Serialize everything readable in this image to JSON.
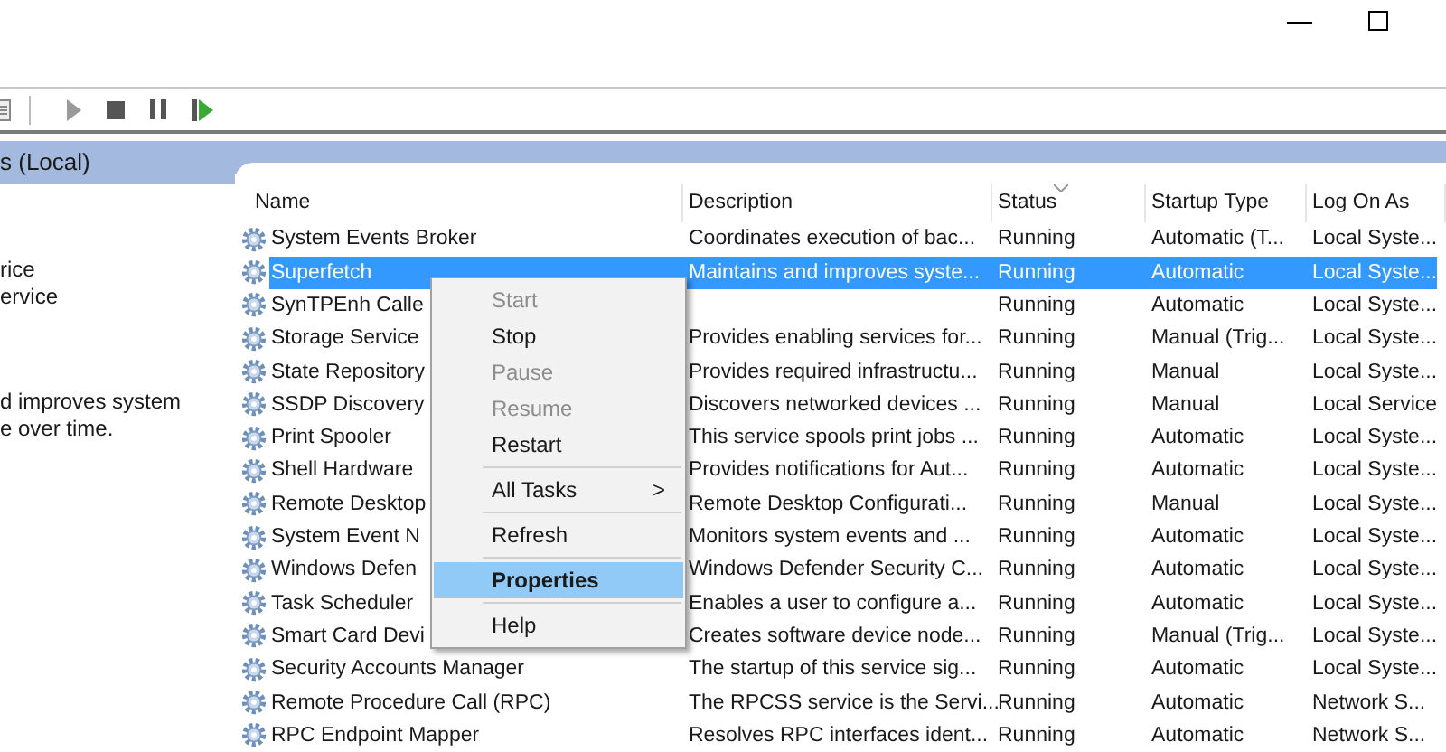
{
  "left_pane": {
    "header": "s (Local)",
    "service_lines": [
      "rice",
      "ervice"
    ],
    "description_lines": [
      "d improves system",
      "e over time."
    ]
  },
  "table": {
    "columns": [
      {
        "label": "Name",
        "sorted": false
      },
      {
        "label": "Description",
        "sorted": false
      },
      {
        "label": "Status",
        "sorted": true
      },
      {
        "label": "Startup Type",
        "sorted": false
      },
      {
        "label": "Log On As",
        "sorted": false
      }
    ],
    "rows": [
      {
        "cells": [
          "System Events Broker",
          "Coordinates execution of bac...",
          "Running",
          "Automatic (T...",
          "Local Syste..."
        ],
        "selected": false
      },
      {
        "cells": [
          "Superfetch",
          "Maintains and improves syste...",
          "Running",
          "Automatic",
          "Local Syste..."
        ],
        "selected": true
      },
      {
        "cells": [
          "SynTPEnh Calle",
          "",
          "Running",
          "Automatic",
          "Local Syste..."
        ],
        "selected": false
      },
      {
        "cells": [
          "Storage Service",
          "Provides enabling services for...",
          "Running",
          "Manual (Trig...",
          "Local Syste..."
        ],
        "selected": false
      },
      {
        "cells": [
          "State Repository",
          "Provides required infrastructu...",
          "Running",
          "Manual",
          "Local Syste..."
        ],
        "selected": false
      },
      {
        "cells": [
          "SSDP Discovery",
          "Discovers networked devices ...",
          "Running",
          "Manual",
          "Local Service"
        ],
        "selected": false
      },
      {
        "cells": [
          "Print Spooler",
          "This service spools print jobs ...",
          "Running",
          "Automatic",
          "Local Syste..."
        ],
        "selected": false
      },
      {
        "cells": [
          "Shell Hardware",
          "Provides notifications for Aut...",
          "Running",
          "Automatic",
          "Local Syste..."
        ],
        "selected": false
      },
      {
        "cells": [
          "Remote Desktop",
          "Remote Desktop Configurati...",
          "Running",
          "Manual",
          "Local Syste..."
        ],
        "selected": false
      },
      {
        "cells": [
          "System Event N",
          "Monitors system events and ...",
          "Running",
          "Automatic",
          "Local Syste..."
        ],
        "selected": false
      },
      {
        "cells": [
          "Windows Defen",
          "Windows Defender Security C...",
          "Running",
          "Automatic",
          "Local Syste..."
        ],
        "selected": false
      },
      {
        "cells": [
          "Task Scheduler",
          "Enables a user to configure a...",
          "Running",
          "Automatic",
          "Local Syste..."
        ],
        "selected": false
      },
      {
        "cells": [
          "Smart Card Devi",
          "Creates software device node...",
          "Running",
          "Manual (Trig...",
          "Local Syste..."
        ],
        "selected": false
      },
      {
        "cells": [
          "Security Accounts Manager",
          "The startup of this service sig...",
          "Running",
          "Automatic",
          "Local Syste..."
        ],
        "selected": false
      },
      {
        "cells": [
          "Remote Procedure Call (RPC)",
          "The RPCSS service is the Servi...",
          "Running",
          "Automatic",
          "Network S..."
        ],
        "selected": false
      },
      {
        "cells": [
          "RPC Endpoint Mapper",
          "Resolves RPC interfaces ident...",
          "Running",
          "Automatic",
          "Network S..."
        ],
        "selected": false
      }
    ]
  },
  "context_menu": {
    "items": [
      {
        "kind": "item",
        "label": "Start",
        "disabled": true,
        "selected": false
      },
      {
        "kind": "item",
        "label": "Stop",
        "disabled": false,
        "selected": false
      },
      {
        "kind": "item",
        "label": "Pause",
        "disabled": true,
        "selected": false
      },
      {
        "kind": "item",
        "label": "Resume",
        "disabled": true,
        "selected": false
      },
      {
        "kind": "item",
        "label": "Restart",
        "disabled": false,
        "selected": false
      },
      {
        "kind": "separator"
      },
      {
        "kind": "item",
        "label": "All Tasks",
        "arrow": ">",
        "disabled": false,
        "selected": false
      },
      {
        "kind": "separator"
      },
      {
        "kind": "item",
        "label": "Refresh",
        "disabled": false,
        "selected": false
      },
      {
        "kind": "separator"
      },
      {
        "kind": "item",
        "label": "Properties",
        "disabled": false,
        "selected": true
      },
      {
        "kind": "separator"
      },
      {
        "kind": "item",
        "label": "Help",
        "disabled": false,
        "selected": false
      }
    ]
  }
}
